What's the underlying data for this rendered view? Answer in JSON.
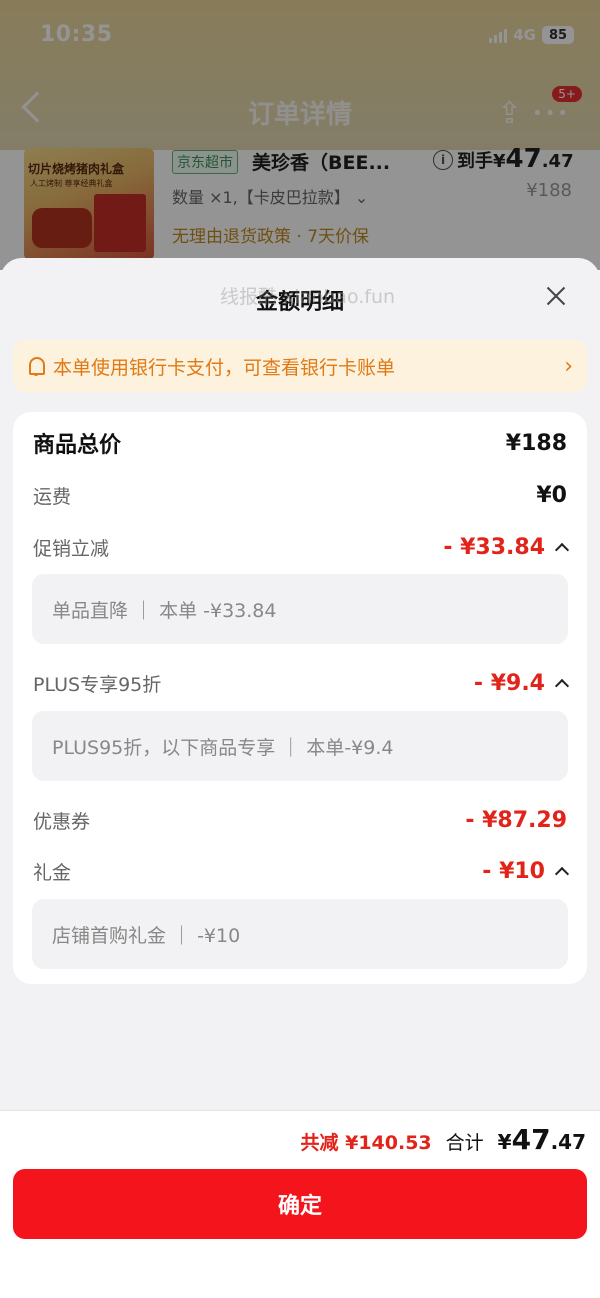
{
  "status_bar": {
    "time": "10:35",
    "network": "4G",
    "battery": "85"
  },
  "nav": {
    "title": "订单详情",
    "badge": "5+"
  },
  "product": {
    "store_tag": "京东超市",
    "name": "美珍香（BEE...",
    "image_title": "切片烧烤猪肉礼盒",
    "image_subtitle": "人工烤制 尊享经典礼盒",
    "final_price_prefix": "到手¥",
    "final_price_int": "47",
    "final_price_dec": ".47",
    "original_price": "¥188",
    "quantity": "数量 ×1,【卡皮巴拉款】",
    "policy": "无理由退货政策 · 7天价保"
  },
  "sheet": {
    "title": "金额明细",
    "watermark": "线报酷 xianbao.fun",
    "notice": "本单使用银行卡支付，可查看银行卡账单",
    "rows": {
      "total": {
        "label": "商品总价",
        "value": "¥188"
      },
      "shipping": {
        "label": "运费",
        "value": "¥0"
      },
      "promo": {
        "label": "促销立减",
        "value": "- ¥33.84",
        "detail": "单品直降  ｜  本单 -¥33.84"
      },
      "plus": {
        "label": "PLUS专享95折",
        "value": "- ¥9.4",
        "detail": "PLUS95折，以下商品专享  ｜  本单-¥9.4"
      },
      "coupon": {
        "label": "优惠券",
        "value": "- ¥87.29"
      },
      "gift": {
        "label": "礼金",
        "value": "- ¥10",
        "detail": "店铺首购礼金  ｜  -¥10"
      }
    }
  },
  "footer": {
    "discount_total": "共减 ¥140.53",
    "sum_label": "合计",
    "sum_prefix": "¥",
    "sum_int": "47",
    "sum_dec": ".47",
    "confirm": "确定"
  },
  "colors": {
    "accent_red": "#f4141c",
    "price_red": "#e2231a",
    "notice_orange": "#e07a16",
    "notice_bg": "#fdf2dd"
  }
}
